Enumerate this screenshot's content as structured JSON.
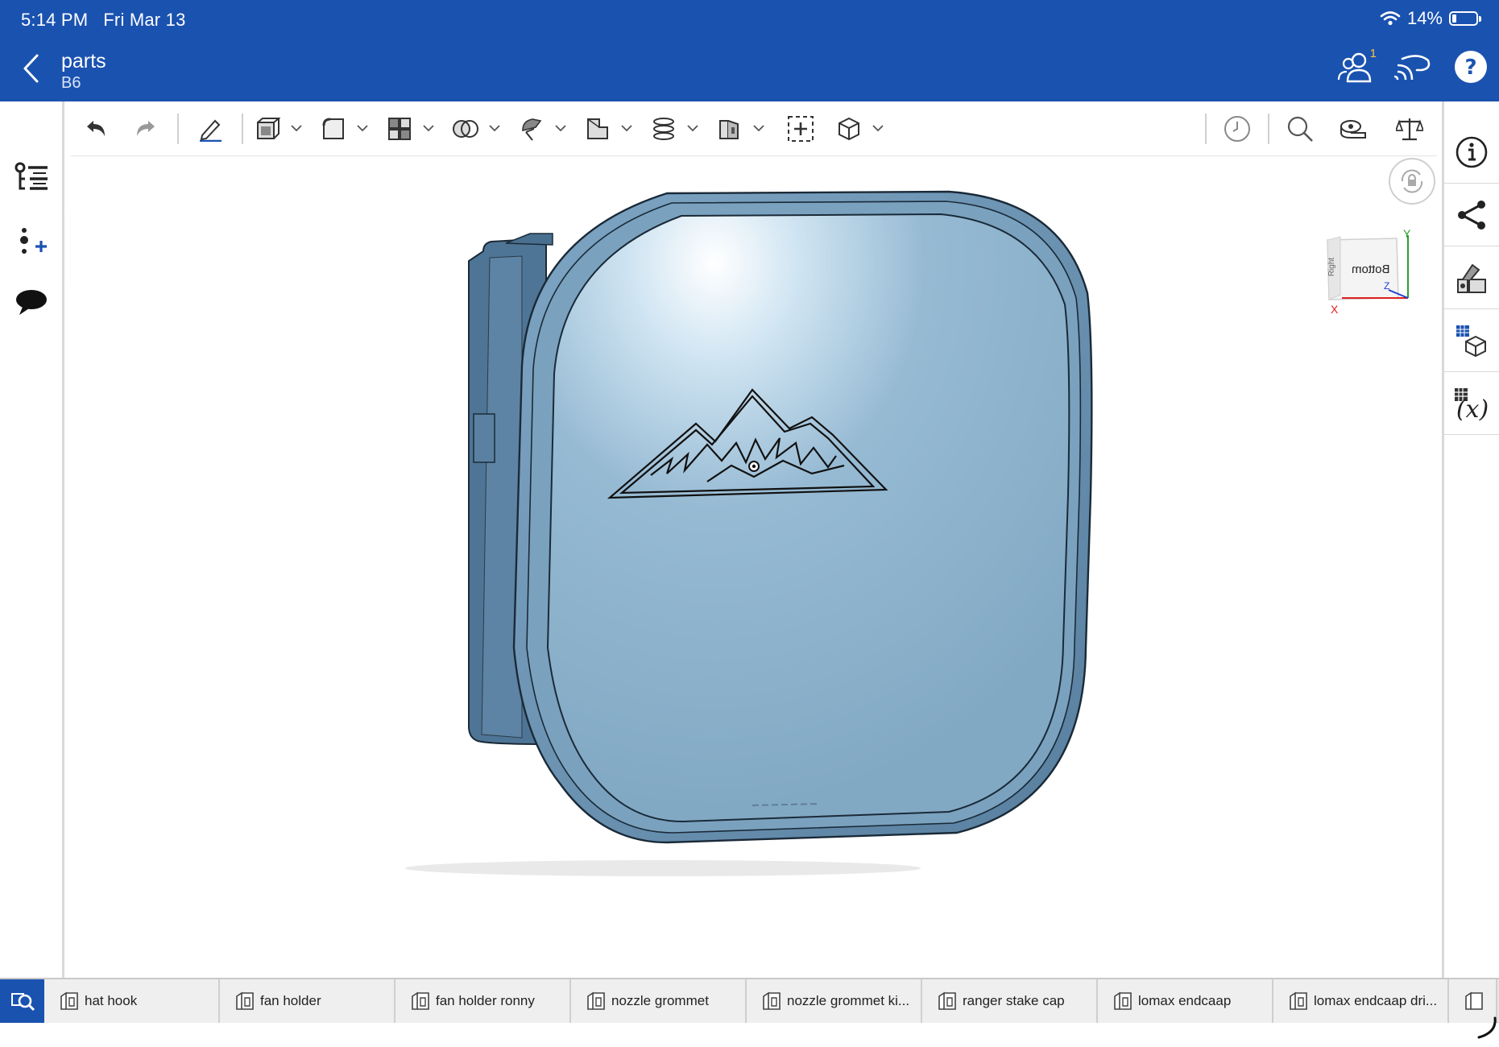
{
  "status": {
    "time": "5:14 PM",
    "date": "Fri Mar 13",
    "battery": "14%"
  },
  "header": {
    "title": "parts",
    "subtitle": "B6",
    "follow_badge": "1"
  },
  "viewcube": {
    "face_label": "Bottom",
    "side_label": "Right",
    "axes": [
      "X",
      "Y",
      "Z"
    ]
  },
  "tabs": [
    {
      "label": "hat hook"
    },
    {
      "label": "fan holder"
    },
    {
      "label": "fan holder ronny"
    },
    {
      "label": "nozzle grommet"
    },
    {
      "label": "nozzle grommet ki..."
    },
    {
      "label": "ranger stake cap"
    },
    {
      "label": "lomax endcaap"
    },
    {
      "label": "lomax endcaap dri..."
    }
  ],
  "colors": {
    "brand_blue": "#1a52b0",
    "model_face": "#86adc8",
    "model_edge": "#5f8aa8",
    "axis_x": "#e02020",
    "axis_y": "#2aa02a",
    "axis_z": "#2040d0"
  },
  "icons": {
    "left_panel": [
      "feature-list-icon",
      "insert-feature-icon",
      "comments-icon"
    ],
    "right_panel": [
      "info-icon",
      "share-icon",
      "appearance-icon",
      "bom-icon",
      "variables-icon"
    ]
  }
}
